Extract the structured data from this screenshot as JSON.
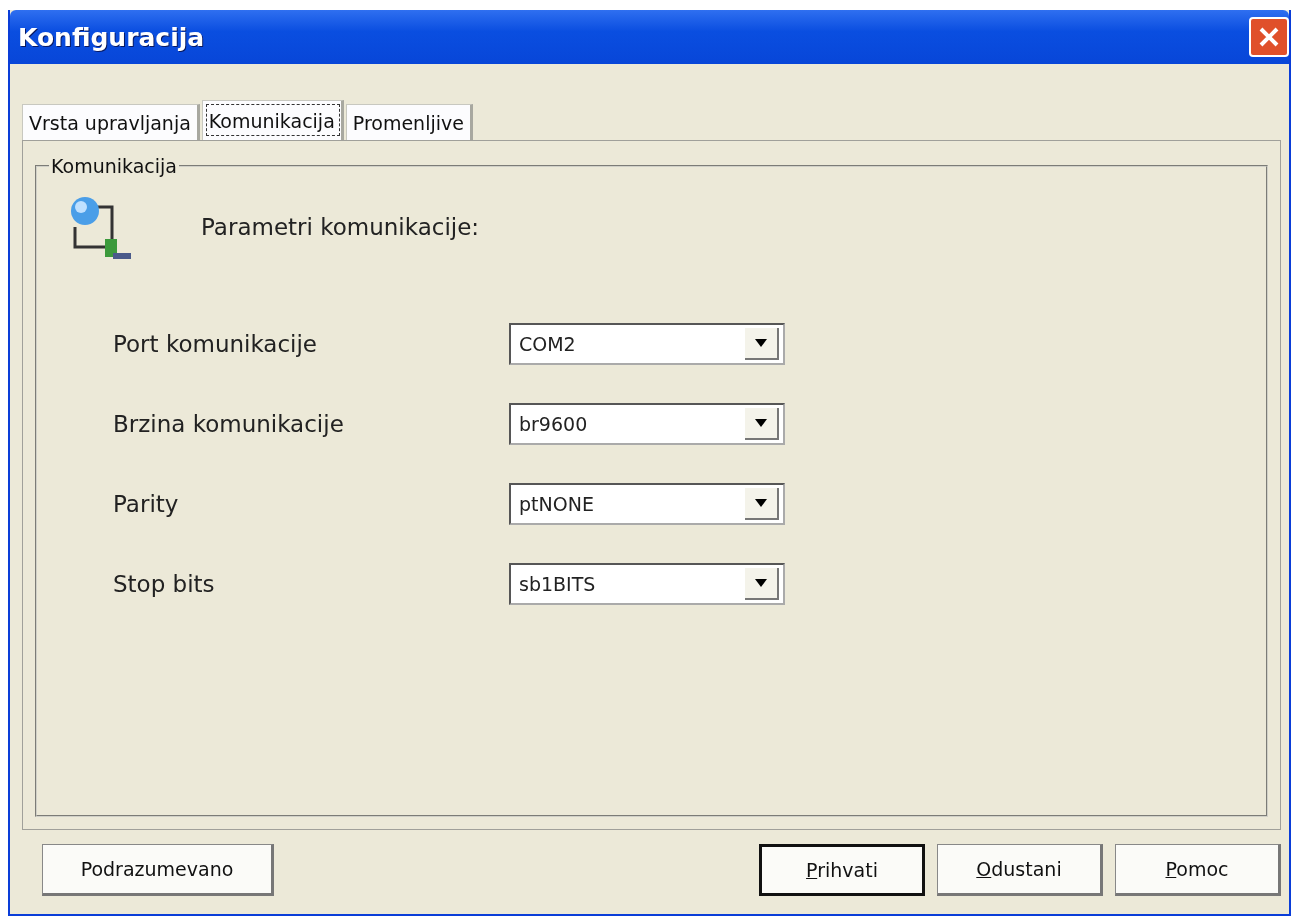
{
  "window": {
    "title": "Konfiguracija"
  },
  "tabs": [
    {
      "label": "Vrsta upravljanja",
      "selected": false
    },
    {
      "label": "Komunikacija",
      "selected": true
    },
    {
      "label": "Promenljive",
      "selected": false
    }
  ],
  "group": {
    "title": "Komunikacija",
    "heading": "Parametri komunikacije:"
  },
  "fields": [
    {
      "label": "Port komunikacije",
      "value": "COM2"
    },
    {
      "label": "Brzina komunikacije",
      "value": "br9600"
    },
    {
      "label": "Parity",
      "value": "ptNONE"
    },
    {
      "label": "Stop bits",
      "value": "sb1BITS"
    }
  ],
  "buttons": [
    {
      "label": "Podrazumevano",
      "default": false,
      "mnemonic": false
    },
    {
      "label": "Prihvati",
      "default": true,
      "mnemonic": true
    },
    {
      "label": "Odustani",
      "default": false,
      "mnemonic": true
    },
    {
      "label": "Pomoc",
      "default": false,
      "mnemonic": true
    }
  ]
}
